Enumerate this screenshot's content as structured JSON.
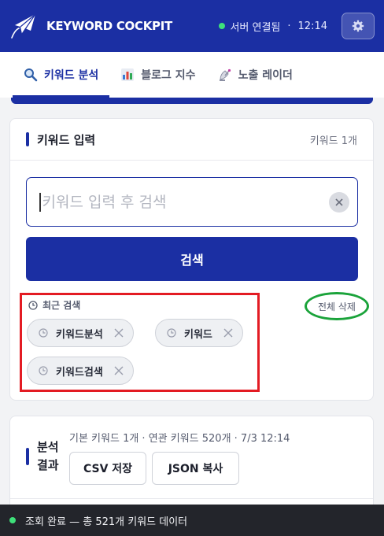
{
  "header": {
    "title": "KEYWORD COCKPIT",
    "server_status": "서버 연결됨",
    "separator": "·",
    "time": "12:14",
    "logo_icon": "paper-plane-icon",
    "settings_icon": "gear-icon"
  },
  "tabs": [
    {
      "label": "키워드 분석",
      "icon": "magnifier-icon",
      "active": true
    },
    {
      "label": "블로그 지수",
      "icon": "bar-chart-icon",
      "active": false
    },
    {
      "label": "노출 레이더",
      "icon": "satellite-icon",
      "active": false
    }
  ],
  "keyword_card": {
    "title": "키워드 입력",
    "count": "키워드 1개",
    "input_placeholder": "키워드 입력 후 검색",
    "input_value": "",
    "search_label": "검색",
    "recent_label": "최근 검색",
    "delete_all_label": "전체 삭제",
    "recent_items": [
      "키워드분석",
      "키워드",
      "키워드검색"
    ]
  },
  "result_card": {
    "title": "분석 결과",
    "meta": "기본 키워드 1개 · 연관 키워드 520개 · 7/3 12:14",
    "csv_label": "CSV 저장",
    "json_label": "JSON 복사"
  },
  "status_bar": {
    "text": "조회 완료 — 총 521개 키워드 데이터"
  },
  "colors": {
    "brand": "#1b2fa3",
    "online": "#3ee07a",
    "highlight_red": "#e31b23",
    "highlight_green": "#1aa33a"
  }
}
